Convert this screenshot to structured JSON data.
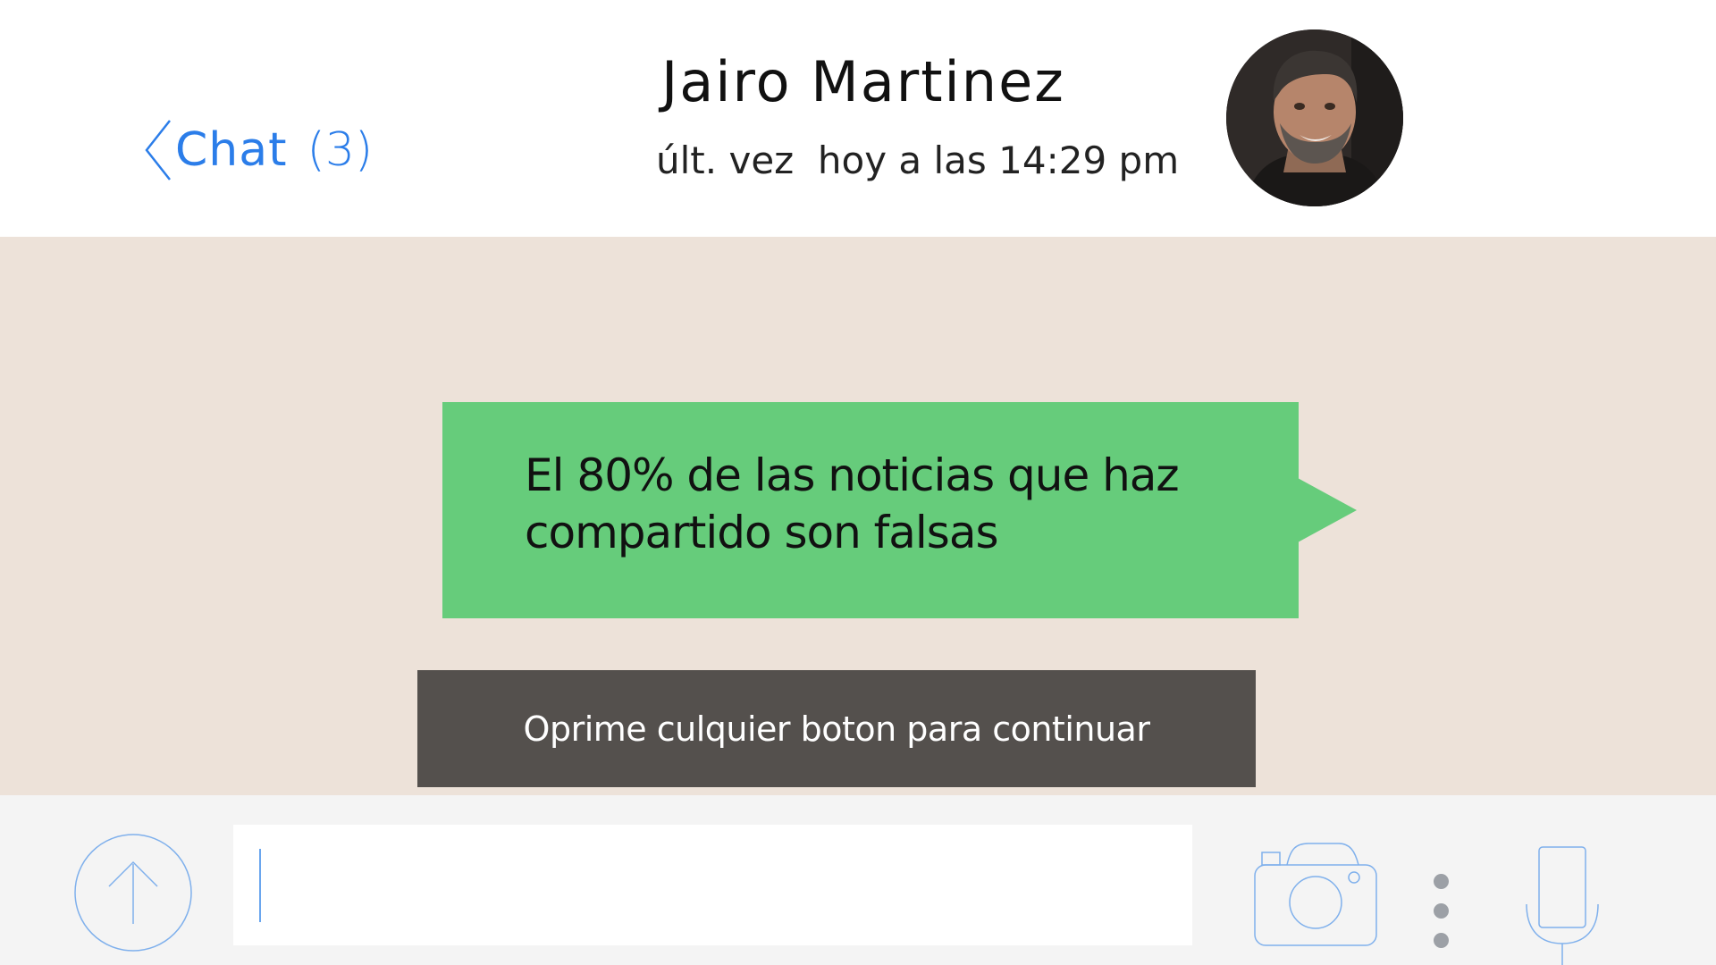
{
  "header": {
    "back_label": "Chat",
    "back_count": "(3)",
    "contact_name": "Jairo Martinez",
    "last_seen": "últ. vez  hoy a las 14:29 pm",
    "avatar_icon": "profile-photo"
  },
  "chat": {
    "message": "El 80% de las noticias que haz compartido son falsas",
    "continue_prompt": "Oprime culquier boton para continuar"
  },
  "composer": {
    "input_value": "",
    "icons": {
      "upload": "arrow-up-circle-icon",
      "camera": "camera-icon",
      "more": "more-vertical-icon",
      "microphone": "microphone-icon"
    }
  },
  "colors": {
    "accent": "#2b7de9",
    "chat_background": "#ede2d9",
    "bubble": "#66cc7b",
    "banner": "#54504d",
    "bottom_bar": "#f4f4f4",
    "icon_outline": "#7fb0ec"
  }
}
